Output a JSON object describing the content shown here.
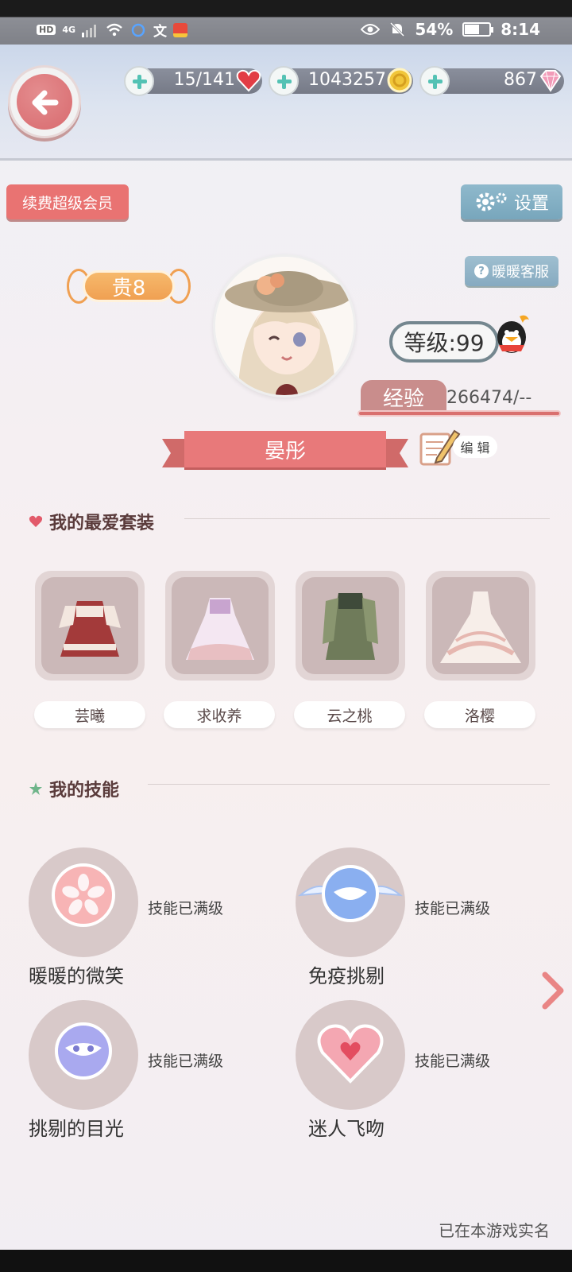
{
  "status_bar": {
    "network": "HD",
    "signal": "4G",
    "ime": "文",
    "battery": "54%",
    "time": "8:14"
  },
  "resources": {
    "stamina": "15/141",
    "gold": "1043257",
    "diamonds": "867"
  },
  "header": {
    "renew_vip": "续费超级会员",
    "settings": "设置",
    "customer_service": "暖暖客服"
  },
  "profile": {
    "vip_level": "贵8",
    "level": "等级:99",
    "exp_label": "经验",
    "exp_value": "266474/--",
    "nickname": "晏彤",
    "edit": "编 辑"
  },
  "favorites": {
    "title": "我的最爱套装",
    "items": [
      {
        "name": "芸曦"
      },
      {
        "name": "求收养"
      },
      {
        "name": "云之桃"
      },
      {
        "name": "洛樱"
      }
    ]
  },
  "skills": {
    "title": "我的技能",
    "items": [
      {
        "name": "暖暖的微笑",
        "status": "技能已满级"
      },
      {
        "name": "免疫挑剔",
        "status": "技能已满级"
      },
      {
        "name": "挑剔的目光",
        "status": "技能已满级"
      },
      {
        "name": "迷人飞吻",
        "status": "技能已满级"
      }
    ]
  },
  "footer": {
    "realname_note": "已在本游戏实名"
  },
  "colors": {
    "accent_pink": "#e8797a",
    "teal_plus": "#53c2b4",
    "settings_blue": "#86aac0"
  }
}
